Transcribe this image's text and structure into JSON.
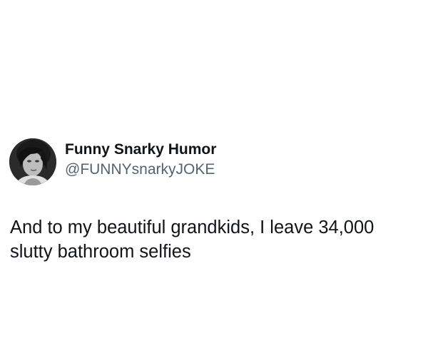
{
  "tweet": {
    "author": {
      "display_name": "Funny Snarky Humor",
      "handle": "@FUNNYsnarkyJOKE",
      "avatar_icon": "profile-photo-grayscale"
    },
    "text": "And to my beautiful grandkids, I leave 34,000\nslutty bathroom selfies"
  }
}
